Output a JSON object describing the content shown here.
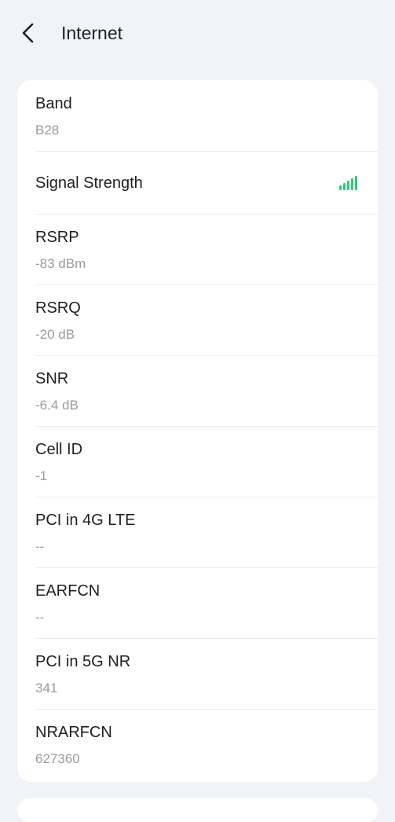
{
  "header": {
    "title": "Internet"
  },
  "items": [
    {
      "label": "Band",
      "value": "B28"
    },
    {
      "label": "Signal Strength"
    },
    {
      "label": "RSRP",
      "value": "-83 dBm"
    },
    {
      "label": "RSRQ",
      "value": "-20 dB"
    },
    {
      "label": "SNR",
      "value": "-6.4 dB"
    },
    {
      "label": "Cell ID",
      "value": "-1"
    },
    {
      "label": "PCI in 4G LTE",
      "value": "--"
    },
    {
      "label": "EARFCN",
      "value": "--"
    },
    {
      "label": "PCI in 5G NR",
      "value": "341"
    },
    {
      "label": "NRARFCN",
      "value": "627360"
    }
  ],
  "signal": {
    "bars_filled": 5,
    "bars_total": 5,
    "color": "#2ecc71"
  },
  "colors": {
    "background": "#f2f3f8",
    "card": "#ffffff",
    "secondary_text": "#9a9aa0"
  }
}
